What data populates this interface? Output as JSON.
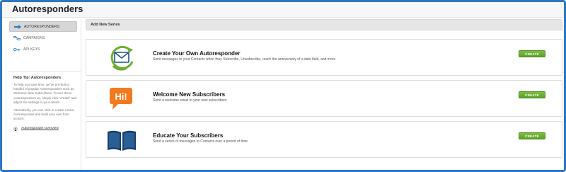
{
  "page": {
    "title": "Autoresponders",
    "accent_color": "#2c78c4",
    "button_color": "#6aaf32"
  },
  "sidebar": {
    "items": [
      {
        "label": "AUTORESPONDERS",
        "icon": "arrow-right-icon",
        "active": true
      },
      {
        "label": "CAMPAIGNS",
        "icon": "campaigns-icon",
        "active": false
      },
      {
        "label": "API KEYS",
        "icon": "key-icon",
        "active": false
      }
    ],
    "help": {
      "title": "Help Tip: Autoresponders",
      "paragraph_1": "To help you save time, we've pre-built a handful of popular Autoresponders such as Welcome New Subscribers. To turn these Autoresponders on, simply click \"create\" and adjust the settings to your needs.",
      "paragraph_2": "Alternatively, you can click to create a New Autoresponder and build your own from scratch.",
      "link_label": "Autoresponder Overview"
    }
  },
  "main": {
    "section_header": "Add New Series",
    "cards": [
      {
        "title": "Create Your Own Autoresponder",
        "description": "Send messages to your Contacts when they Subscribe, Unsubscribe, reach the anniversary of a date field, and more",
        "button_label": "CREATE",
        "icon": "envelope-cycle-icon"
      },
      {
        "title": "Welcome New Subscribers",
        "description": "Send a welcome email to your new subscribers",
        "button_label": "CREATE",
        "icon": "hi-speech-bubble-icon",
        "icon_text": "Hi!"
      },
      {
        "title": "Educate Your Subscribers",
        "description": "Send a series of messages to Contacts over a period of time",
        "button_label": "CREATE",
        "icon": "open-book-icon"
      }
    ]
  }
}
